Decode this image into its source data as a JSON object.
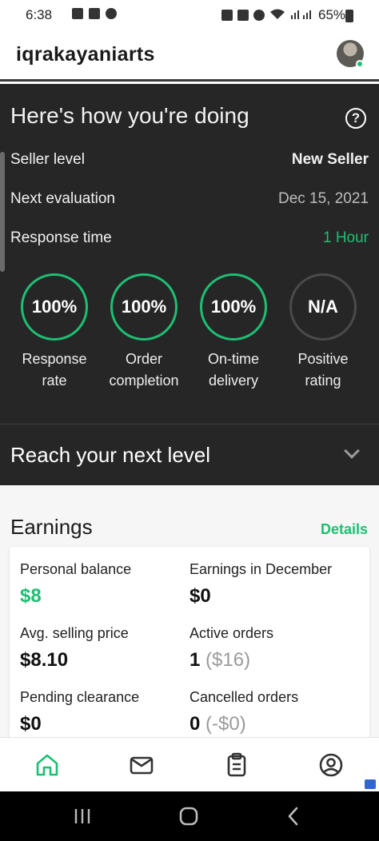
{
  "status_bar": {
    "time": "6:38",
    "battery": "65%"
  },
  "header": {
    "username": "iqrakayaniarts"
  },
  "dashboard": {
    "title": "Here's how you're doing",
    "rows": [
      {
        "label": "Seller level",
        "value": "New Seller"
      },
      {
        "label": "Next evaluation",
        "value": "Dec 15, 2021"
      },
      {
        "label": "Response time",
        "value": "1 Hour"
      }
    ],
    "metrics": [
      {
        "value": "100%",
        "label_line1": "Response",
        "label_line2": "rate"
      },
      {
        "value": "100%",
        "label_line1": "Order",
        "label_line2": "completion"
      },
      {
        "value": "100%",
        "label_line1": "On-time",
        "label_line2": "delivery"
      },
      {
        "value": "N/A",
        "label_line1": "Positive",
        "label_line2": "rating"
      }
    ]
  },
  "reach": {
    "title": "Reach your next level"
  },
  "earnings": {
    "title": "Earnings",
    "details_label": "Details",
    "items": [
      {
        "label": "Personal balance",
        "value": "$8"
      },
      {
        "label": "Earnings in December",
        "value": "$0"
      },
      {
        "label": "Avg. selling price",
        "value": "$8.10"
      },
      {
        "label": "Active orders",
        "value": "1",
        "sub": "($16)"
      },
      {
        "label": "Pending clearance",
        "value": "$0"
      },
      {
        "label": "Cancelled orders",
        "value": "0",
        "sub": "(-$0)"
      }
    ]
  },
  "colors": {
    "accent": "#1dbf73",
    "panel_bg": "#262626"
  },
  "bottom_nav": {
    "items": [
      "home-icon",
      "messages-icon",
      "orders-icon",
      "profile-icon"
    ]
  }
}
